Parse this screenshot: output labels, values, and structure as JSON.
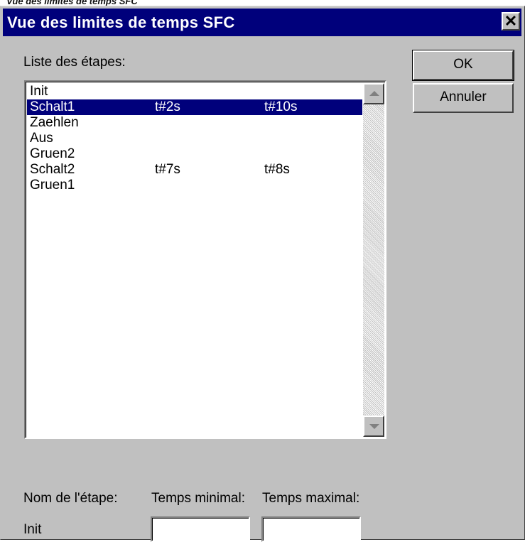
{
  "caption": "Vue des limites de temps SFC",
  "dialog": {
    "title": "Vue des limites de temps SFC",
    "close_symbol": "✕"
  },
  "list_label": "Liste des étapes:",
  "steps": [
    {
      "name": "Init",
      "min": "",
      "max": ""
    },
    {
      "name": "Schalt1",
      "min": "t#2s",
      "max": "t#10s"
    },
    {
      "name": "Zaehlen",
      "min": "",
      "max": ""
    },
    {
      "name": "Aus",
      "min": "",
      "max": ""
    },
    {
      "name": "Gruen2",
      "min": "",
      "max": ""
    },
    {
      "name": "Schalt2",
      "min": "t#7s",
      "max": "t#8s"
    },
    {
      "name": "Gruen1",
      "min": "",
      "max": ""
    }
  ],
  "selected_step_index": 1,
  "buttons": {
    "ok_label": "OK",
    "cancel_label": "Annuler"
  },
  "footer": {
    "step_name_label": "Nom de l'étape:",
    "min_time_label": "Temps minimal:",
    "max_time_label": "Temps maximal:",
    "step_name_value": "Init",
    "min_time_value": "",
    "max_time_value": ""
  },
  "colors": {
    "titlebar": "#00007b",
    "selection": "#00007b",
    "dialog_face": "#c0c0c0"
  },
  "icons": {
    "close": "close-icon",
    "scroll_up": "arrow-up-icon",
    "scroll_down": "arrow-down-icon"
  }
}
